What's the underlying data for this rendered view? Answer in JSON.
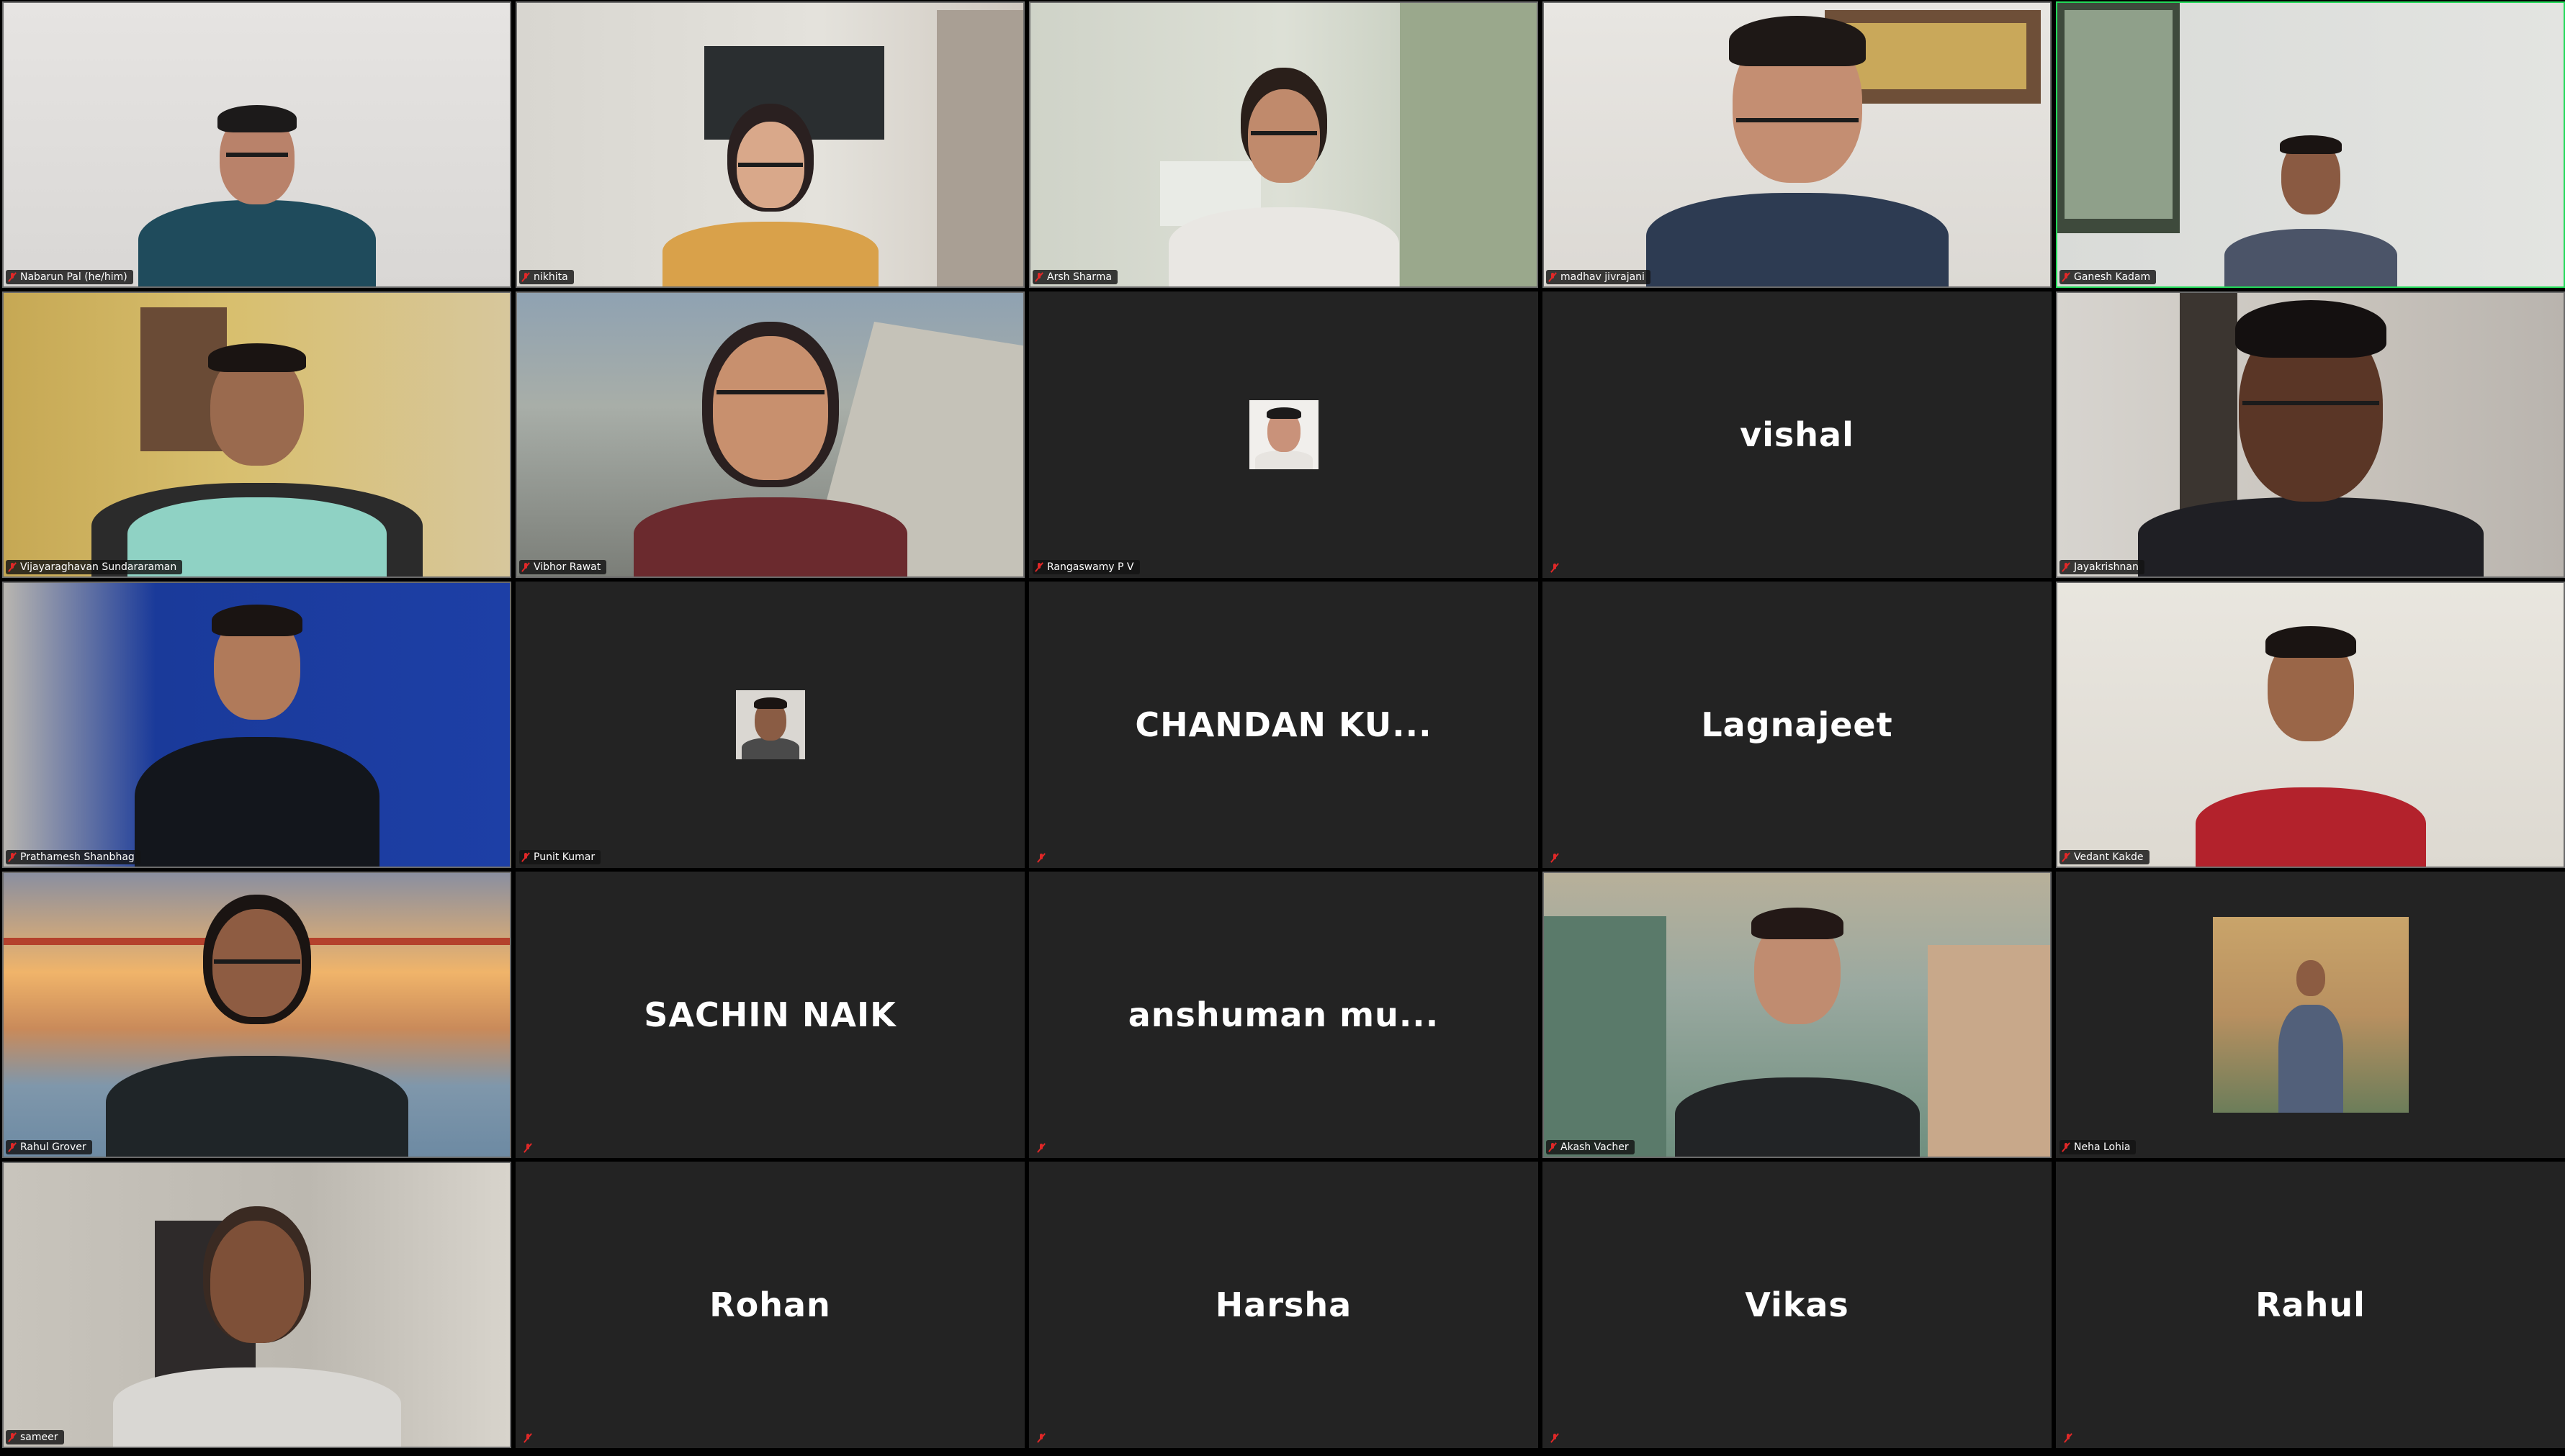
{
  "meeting": {
    "tiles": [
      {
        "name": "Nabarun Pal (he/him)"
      },
      {
        "name": "nikhita"
      },
      {
        "name": "Arsh Sharma"
      },
      {
        "name": "madhav jivrajani"
      },
      {
        "name": "Ganesh Kadam"
      },
      {
        "name": "Vijayaraghavan Sundararaman"
      },
      {
        "name": "Vibhor Rawat"
      },
      {
        "name": "Rangaswamy P V"
      },
      {
        "display_name": "vishal"
      },
      {
        "name": "Jayakrishnan"
      },
      {
        "name": "Prathamesh Shanbhag"
      },
      {
        "name": "Punit Kumar"
      },
      {
        "display_name": "CHANDAN KU..."
      },
      {
        "display_name": "Lagnajeet"
      },
      {
        "name": "Vedant Kakde"
      },
      {
        "name": "Rahul Grover"
      },
      {
        "display_name": "SACHIN NAIK"
      },
      {
        "display_name": "anshuman mu..."
      },
      {
        "name": "Akash Vacher"
      },
      {
        "name": "Neha Lohia"
      },
      {
        "name": "sameer"
      },
      {
        "display_name": "Rohan"
      },
      {
        "display_name": "Harsha"
      },
      {
        "display_name": "Vikas"
      },
      {
        "display_name": "Rahul"
      }
    ],
    "active_speaker": "Ganesh Kadam",
    "colors": {
      "active_border": "#23d959",
      "tile_background": "#232323",
      "muted_icon": "#e02828"
    },
    "icons": {
      "muted": "mic-muted-icon"
    }
  }
}
